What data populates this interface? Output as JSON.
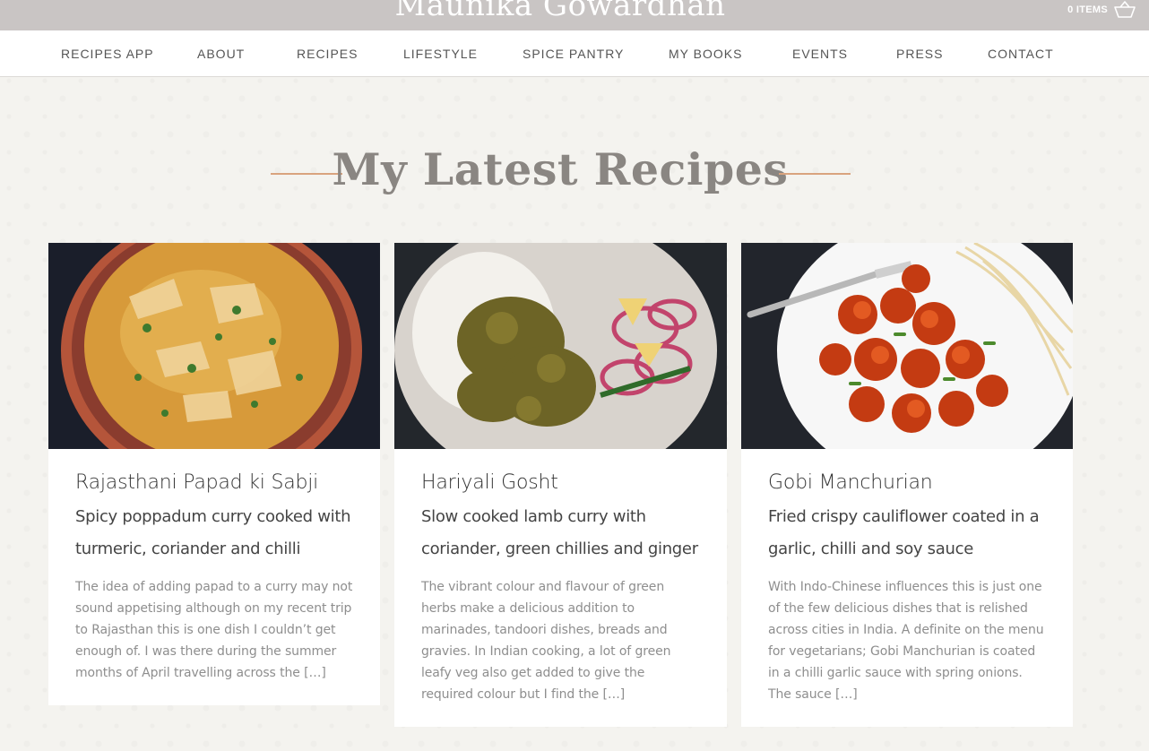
{
  "site": {
    "title": "Maunika Gowardhan",
    "cart_label": "0 ITEMS"
  },
  "nav": {
    "items": [
      "RECIPES APP",
      "ABOUT",
      "RECIPES",
      "LIFESTYLE",
      "SPICE PANTRY",
      "MY BOOKS",
      "EVENTS",
      "PRESS",
      "CONTACT"
    ]
  },
  "section": {
    "heading": "My Latest Recipes"
  },
  "recipes": [
    {
      "title": "Rajasthani Papad ki Sabji",
      "subtitle": "Spicy poppadum curry cooked with turmeric, coriander and chilli",
      "excerpt": "The idea of adding papad to a curry may not sound appetising although on my recent trip to Rajasthan this is one dish I couldn’t get enough of. I was there during the summer months of April travelling across the […]"
    },
    {
      "title": "Hariyali Gosht",
      "subtitle": "Slow cooked lamb curry with coriander, green chillies and ginger",
      "excerpt": "The vibrant colour and flavour of green herbs make a delicious addition to marinades, tandoori dishes, breads and gravies. In Indian cooking, a lot of green leafy veg also get added to give the required colour but I find the […]"
    },
    {
      "title": "Gobi Manchurian",
      "subtitle": "Fried crispy cauliflower coated in a garlic, chilli and soy sauce",
      "excerpt": "With Indo-Chinese influences this is just one of the few delicious dishes that is relished across cities in India. A definite on the menu for vegetarians; Gobi Manchurian is coated in a chilli garlic sauce with spring onions. The sauce […]"
    }
  ],
  "icons": {
    "cart": "basket-icon"
  },
  "colors": {
    "topbar": "#c9c5c4",
    "accent": "#d9a37e",
    "heading": "#8a8682"
  }
}
